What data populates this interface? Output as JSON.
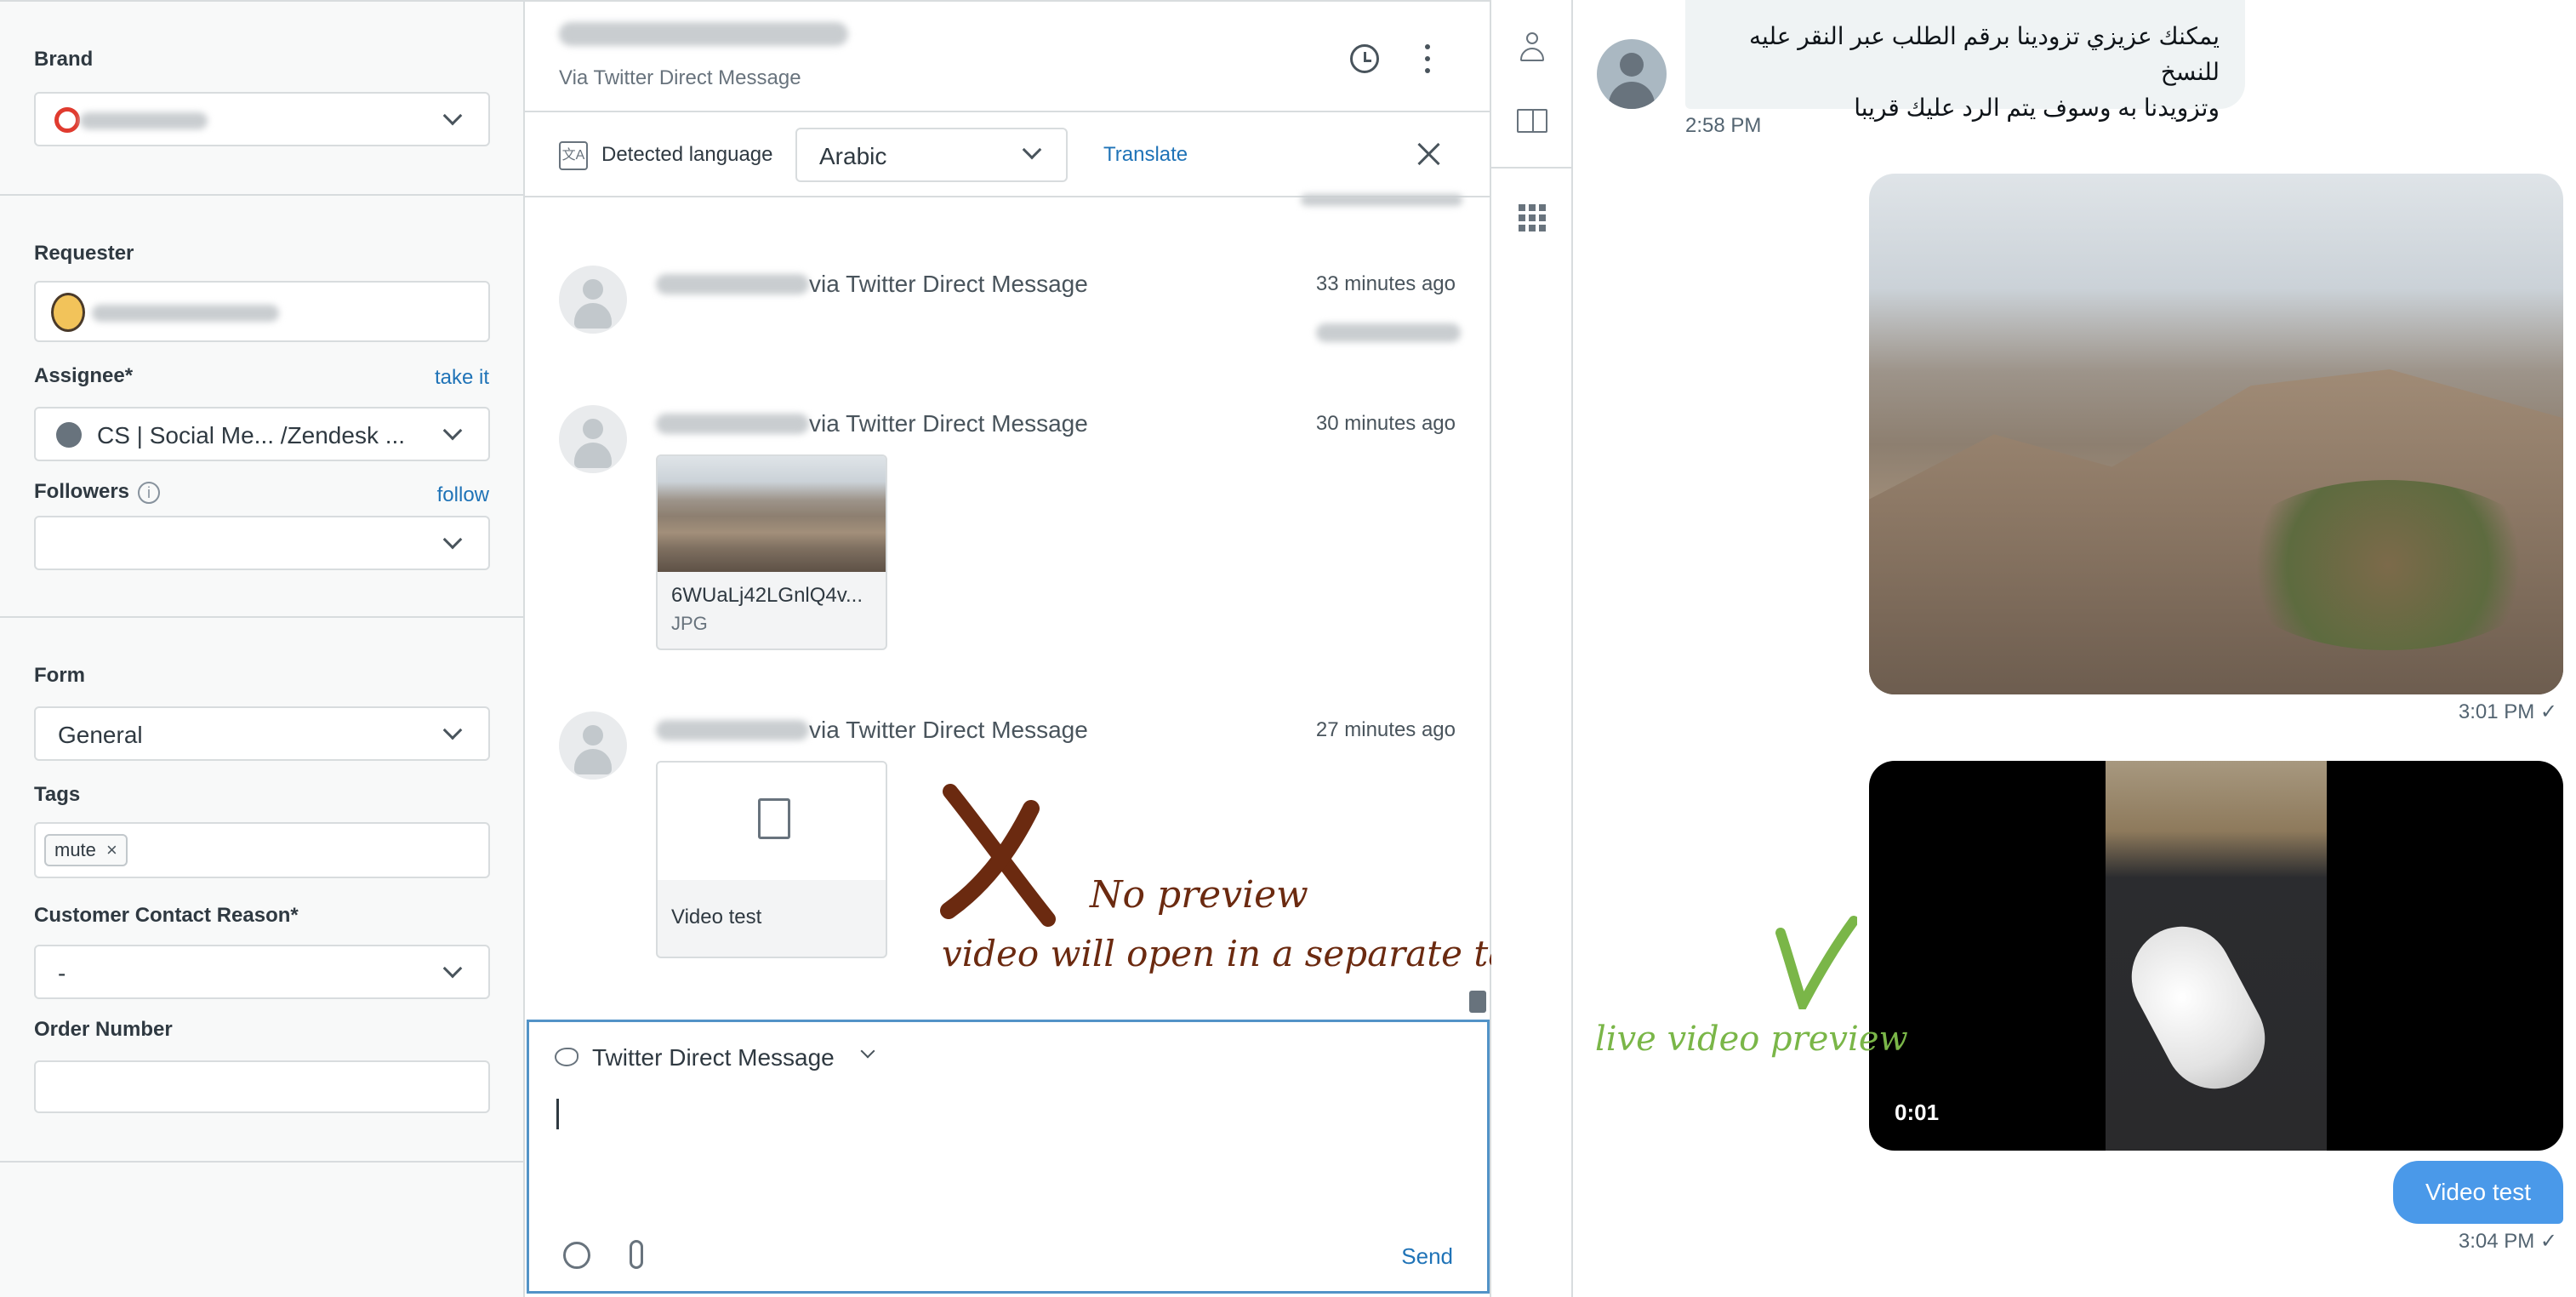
{
  "left_panel": {
    "brand": {
      "label": "Brand"
    },
    "requester": {
      "label": "Requester"
    },
    "assignee": {
      "label": "Assignee*",
      "action": "take it",
      "value": "CS | Social Me...  /Zendesk ..."
    },
    "followers": {
      "label": "Followers",
      "action": "follow"
    },
    "form": {
      "label": "Form",
      "value": "General"
    },
    "tags": {
      "label": "Tags",
      "items": [
        "mute"
      ]
    },
    "contact_reason": {
      "label": "Customer Contact Reason*",
      "value": "-"
    },
    "order_number": {
      "label": "Order Number"
    }
  },
  "conversation": {
    "header": {
      "channel": "Via Twitter Direct Message"
    },
    "translate_bar": {
      "label": "Detected language",
      "language": "Arabic",
      "translate": "Translate"
    },
    "messages": [
      {
        "via": "via Twitter Direct Message",
        "time": "33 minutes ago"
      },
      {
        "via": "via Twitter Direct Message",
        "time": "30 minutes ago",
        "attachment": {
          "name": "6WUaLj42LGnlQ4v...",
          "type": "JPG"
        }
      },
      {
        "via": "via Twitter Direct Message",
        "time": "27 minutes ago",
        "attachment": {
          "name": "Video test"
        }
      }
    ],
    "annotation": {
      "title": "No preview",
      "subtitle": "video will open in a separate tab"
    },
    "composer": {
      "channel": "Twitter Direct Message",
      "send": "Send"
    }
  },
  "dm": {
    "incoming": {
      "text_line1": "يمكنك عزيزي تزودينا برقم الطلب عبر النقر عليه للنسخ",
      "text_line2": "وتزويدنا به وسوف يتم الرد عليك قريبا",
      "time": "2:58 PM"
    },
    "image_time": "3:01 PM ✓",
    "video": {
      "duration": "0:01"
    },
    "annotation": "live video preview",
    "outgoing": {
      "text": "Video test",
      "time": "3:04 PM ✓"
    }
  },
  "colors": {
    "link": "#1f73b7",
    "dm_blue": "#4a99e9",
    "annotation_red": "#6b2a10",
    "annotation_green": "#7ab648"
  }
}
